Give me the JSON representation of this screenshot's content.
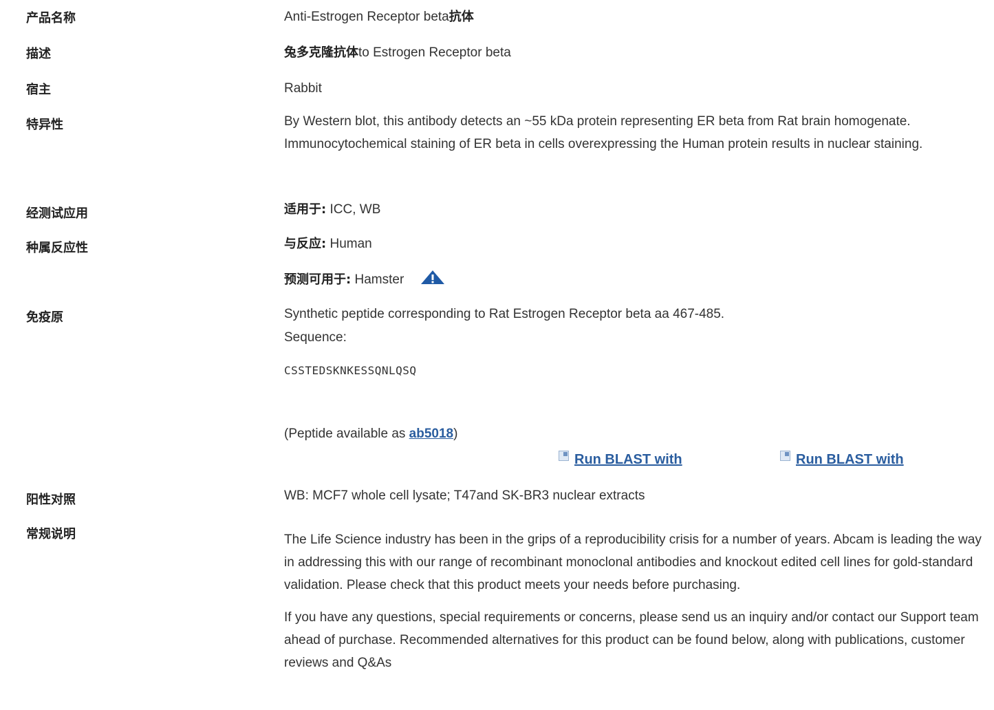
{
  "rows": {
    "product_name": {
      "label": "产品名称",
      "value_prefix": "Anti-Estrogen Receptor beta",
      "value_suffix": "抗体"
    },
    "description": {
      "label": "描述",
      "value_prefix": "兔多克隆抗体",
      "value_suffix": "to Estrogen Receptor beta"
    },
    "host": {
      "label": "宿主",
      "value": "Rabbit"
    },
    "specificity": {
      "label": "特异性",
      "value": "By Western blot, this antibody detects an ~55 kDa protein representing ER beta from Rat brain homogenate. Immunocytochemical staining of ER beta in cells overexpressing the Human protein results in nuclear staining."
    },
    "tested_applications": {
      "label": "经测试应用",
      "prefix": "适用于:",
      "value": " ICC, WB"
    },
    "species_reactivity": {
      "label": "种属反应性",
      "reacts_prefix": "与反应:",
      "reacts_value": " Human",
      "predicted_prefix": "预测可用于:",
      "predicted_value": " Hamster",
      "warning_icon": "warning-triangle-icon"
    },
    "immunogen": {
      "label": "免疫原",
      "line1": "Synthetic peptide corresponding to Rat Estrogen Receptor beta aa 467-485.",
      "line2": "Sequence:",
      "sequence": "CSSTEDSKNKESSQNLQSQ",
      "peptide_prefix": "(Peptide available as ",
      "peptide_link": "ab5018",
      "peptide_suffix": ")",
      "blast_1": "Run BLAST with",
      "blast_2": "Run BLAST with"
    },
    "positive_control": {
      "label": "阳性对照",
      "value": "WB: MCF7 whole cell lysate; T47and SK-BR3 nuclear extracts"
    },
    "general_notes": {
      "label": "常规说明",
      "para1": "The Life Science industry has been in the grips of a reproducibility crisis for a number of years. Abcam is leading the way in addressing this with our range of recombinant monoclonal antibodies and knockout edited cell lines for gold-standard validation. Please check that this product meets your needs before purchasing.",
      "para2": "If you have any questions, special requirements or concerns, please send us an inquiry and/or contact our Support team ahead of purchase. Recommended alternatives for this product can be found below, along with publications, customer reviews and Q&As"
    }
  },
  "colors": {
    "link": "#2a5d9f",
    "warning_icon": "#1f5aa6"
  }
}
